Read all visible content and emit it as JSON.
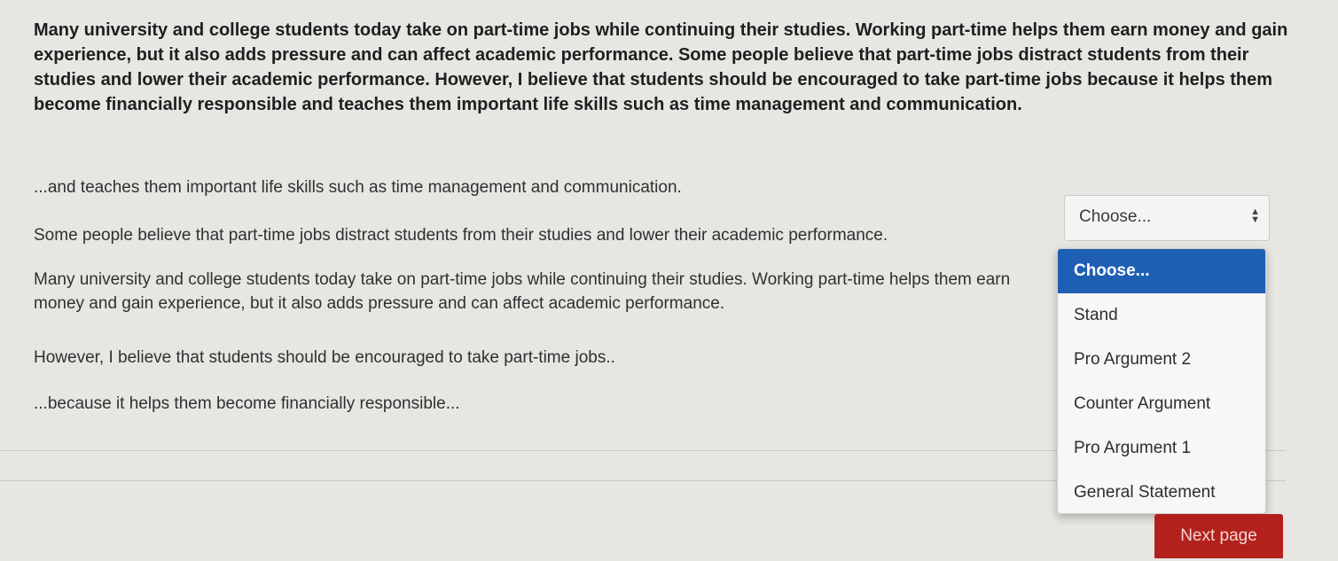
{
  "intro_paragraph": "Many university and college students today take on part-time jobs while continuing their studies. Working part-time helps them earn money and gain experience, but it also adds pressure and can affect academic performance. Some people believe that part-time jobs distract students from their studies and lower their academic performance. However, I believe that students should be encouraged to take part-time jobs because it helps them become financially responsible and teaches them important life skills such as time management and communication.",
  "questions": [
    {
      "text": "...and teaches them important life skills such as time management and communication."
    },
    {
      "text": "Some people believe that part-time jobs distract students from their studies and lower their academic performance."
    },
    {
      "text": "Many university and college students today take on part-time jobs while continuing their studies. Working part-time helps them earn money and gain experience, but it also adds pressure and can affect academic performance."
    },
    {
      "text": "However, I believe that students should be encouraged to take part-time jobs.."
    },
    {
      "text": "...because it helps them become financially responsible..."
    }
  ],
  "select": {
    "current_value": "Choose...",
    "options": [
      "Choose...",
      "Stand",
      "Pro Argument 2",
      "Counter Argument",
      "Pro Argument 1",
      "General Statement"
    ],
    "highlighted_option": "Choose..."
  },
  "navigation": {
    "next_label": "Next page"
  },
  "colors": {
    "highlight": "#1f5fb3",
    "next_button": "#b3211c",
    "background": "#e7e6e3"
  }
}
